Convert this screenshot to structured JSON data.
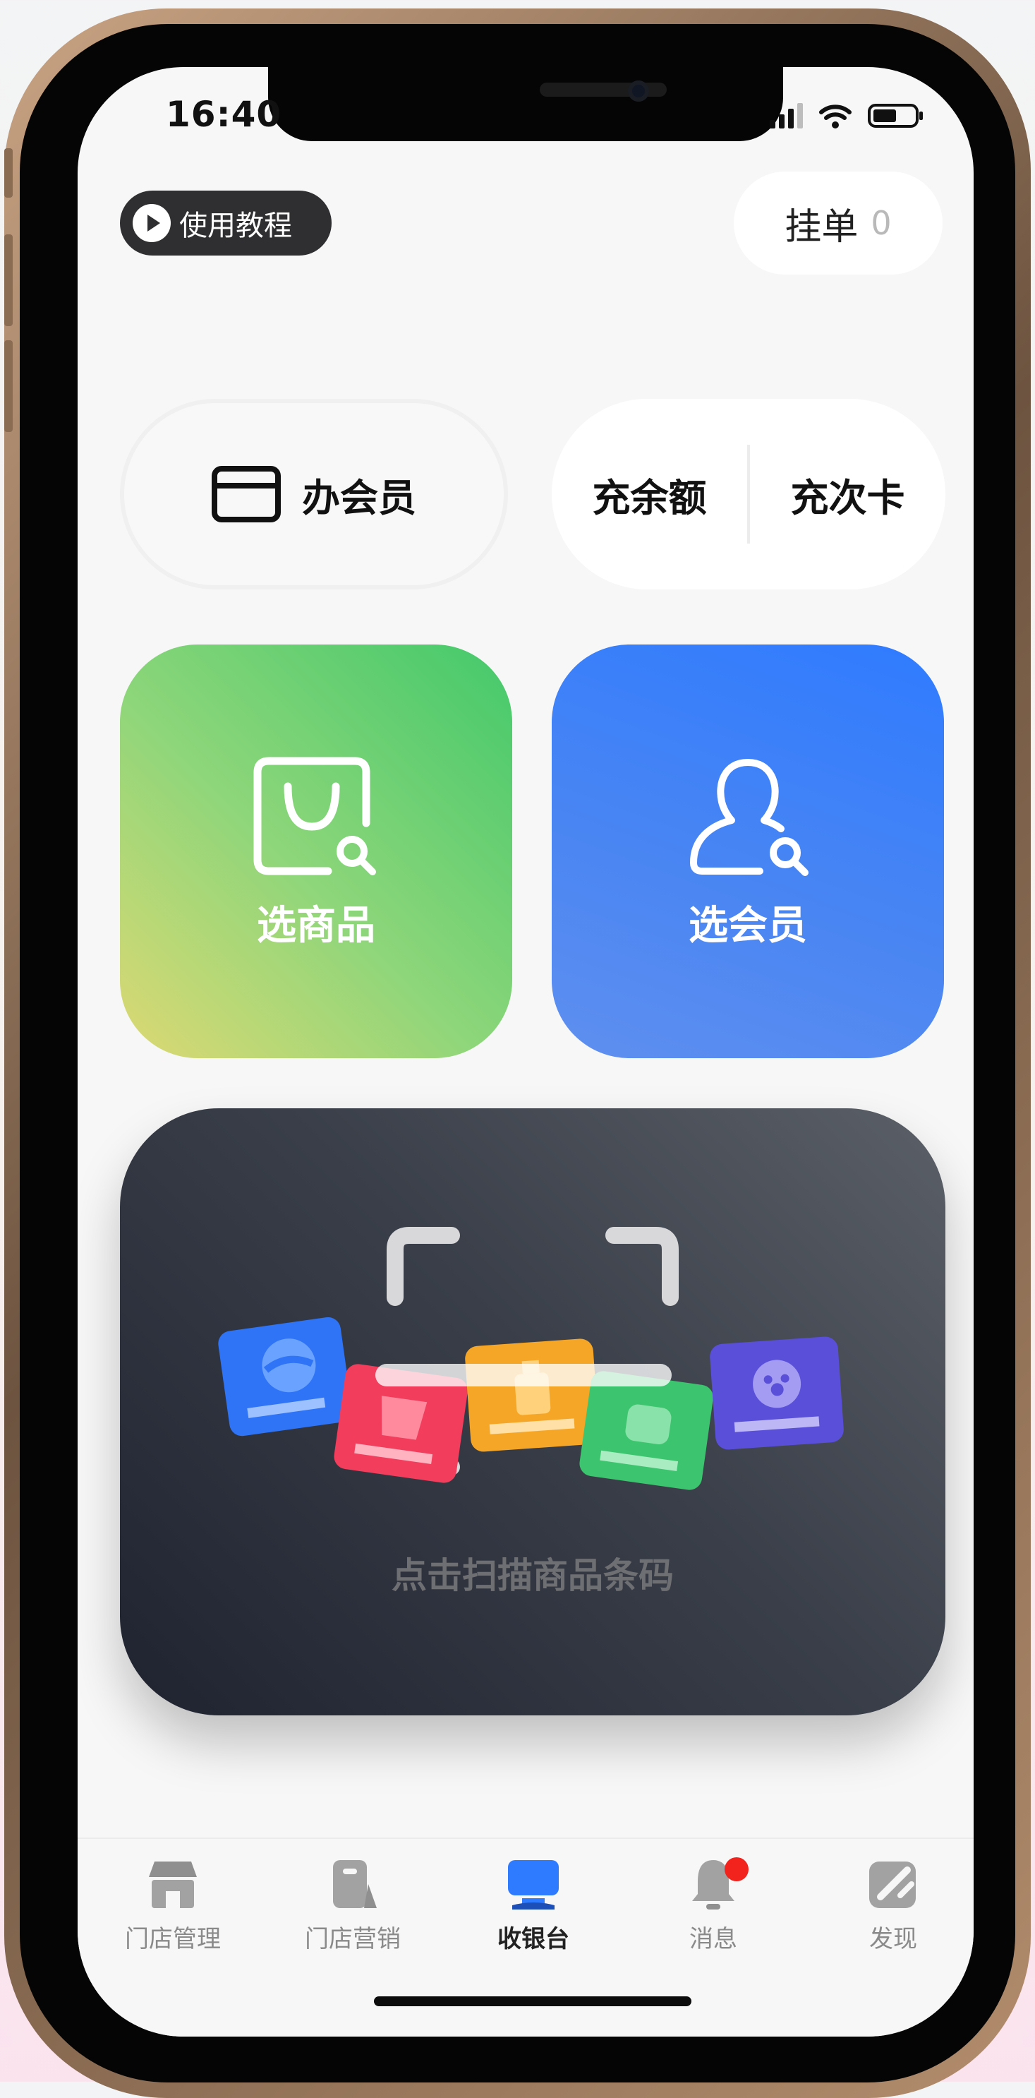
{
  "status_bar": {
    "time": "16:40"
  },
  "header": {
    "tutorial_label": "使用教程",
    "pending_label": "挂单",
    "pending_count": "0"
  },
  "actions": {
    "member_label": "办会员",
    "recharge_balance_label": "充余额",
    "recharge_card_label": "充次卡"
  },
  "tiles": {
    "goods_label": "选商品",
    "member_label": "选会员"
  },
  "scan": {
    "hint": "点击扫描商品条码"
  },
  "tabbar": {
    "items": [
      {
        "label": "门店管理",
        "icon": "store-icon"
      },
      {
        "label": "门店营销",
        "icon": "marketing-icon"
      },
      {
        "label": "收银台",
        "icon": "cashier-icon",
        "active": true
      },
      {
        "label": "消息",
        "icon": "bell-icon",
        "badge": true
      },
      {
        "label": "发现",
        "icon": "discover-icon"
      }
    ]
  },
  "colors": {
    "goods_tile": "#43c96b",
    "member_tile": "#2f7bff",
    "scan_panel": "#2b303a",
    "active_tab": "#2f7bff",
    "badge": "#f2221c"
  }
}
